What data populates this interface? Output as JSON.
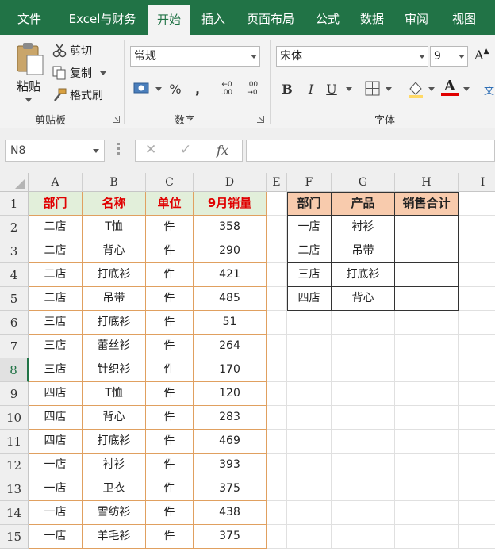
{
  "tabs": [
    "文件",
    "Excel与财务",
    "开始",
    "插入",
    "页面布局",
    "公式",
    "数据",
    "审阅",
    "视图"
  ],
  "active_tab": "开始",
  "clipboard": {
    "paste_label": "粘贴",
    "cut_label": "剪切",
    "copy_label": "复制",
    "format_painter_label": "格式刷",
    "group_label": "剪贴板"
  },
  "number": {
    "format_value": "常规",
    "percent_symbol": "%",
    "comma_symbol": ",",
    "increase_decimal": "←0 .00",
    "decrease_decimal": ".00 →0",
    "group_label": "数字"
  },
  "font": {
    "name_value": "宋体",
    "size_value": "9",
    "grow_symbol": "A",
    "bold": "B",
    "italic": "I",
    "underline": "U",
    "font_color_symbol": "A",
    "group_label": "字体",
    "wen_symbol": "文"
  },
  "formula_bar": {
    "name_box": "N8",
    "cancel_symbol": "✕",
    "enter_symbol": "✓",
    "fx_symbol": "fx",
    "value": ""
  },
  "columns": [
    "A",
    "B",
    "C",
    "D",
    "E",
    "F",
    "G",
    "H",
    "I"
  ],
  "rows": [
    "1",
    "2",
    "3",
    "4",
    "5",
    "6",
    "7",
    "8",
    "9",
    "10",
    "11",
    "12",
    "13",
    "14",
    "15"
  ],
  "selected_row": "8",
  "sales_table": {
    "headers": [
      "部门",
      "名称",
      "单位",
      "9月销量"
    ],
    "rows": [
      [
        "二店",
        "T恤",
        "件",
        "358"
      ],
      [
        "二店",
        "背心",
        "件",
        "290"
      ],
      [
        "二店",
        "打底衫",
        "件",
        "421"
      ],
      [
        "二店",
        "吊带",
        "件",
        "485"
      ],
      [
        "三店",
        "打底衫",
        "件",
        "51"
      ],
      [
        "三店",
        "蕾丝衫",
        "件",
        "264"
      ],
      [
        "三店",
        "针织衫",
        "件",
        "170"
      ],
      [
        "四店",
        "T恤",
        "件",
        "120"
      ],
      [
        "四店",
        "背心",
        "件",
        "283"
      ],
      [
        "四店",
        "打底衫",
        "件",
        "469"
      ],
      [
        "一店",
        "衬衫",
        "件",
        "393"
      ],
      [
        "一店",
        "卫衣",
        "件",
        "375"
      ],
      [
        "一店",
        "雪纺衫",
        "件",
        "438"
      ],
      [
        "一店",
        "羊毛衫",
        "件",
        "375"
      ]
    ]
  },
  "summary_table": {
    "headers": [
      "部门",
      "产品",
      "销售合计"
    ],
    "rows": [
      [
        "一店",
        "衬衫",
        ""
      ],
      [
        "二店",
        "吊带",
        ""
      ],
      [
        "三店",
        "打底衫",
        ""
      ],
      [
        "四店",
        "背心",
        ""
      ]
    ]
  },
  "colors": {
    "excel_green": "#217346",
    "header_green_fill": "#e2efda",
    "header_red_text": "#e00000",
    "summary_header_fill": "#f8cbad",
    "table_border_orange": "#e0a060"
  }
}
